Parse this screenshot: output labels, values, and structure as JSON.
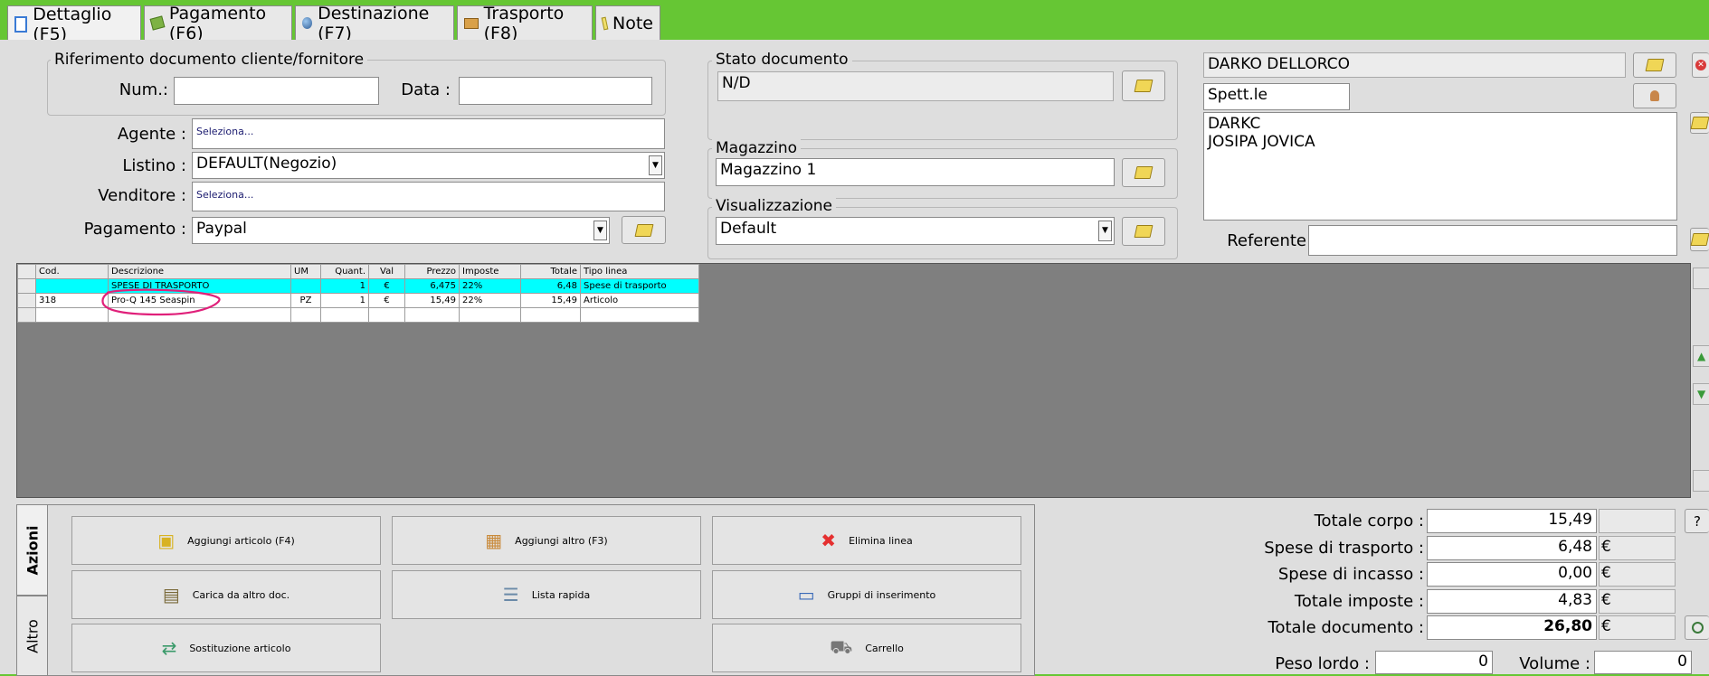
{
  "tabs": [
    {
      "label": "Dettaglio (F5)",
      "icon": "document-icon",
      "color": "#3a7bd5"
    },
    {
      "label": "Pagamento (F6)",
      "icon": "money-icon",
      "color": "#5a8f29"
    },
    {
      "label": "Destinazione (F7)",
      "icon": "globe-icon",
      "color": "#3b6ea8"
    },
    {
      "label": "Trasporto (F8)",
      "icon": "truck-icon",
      "color": "#c08a30"
    },
    {
      "label": "Note",
      "icon": "note-icon",
      "color": "#e8d552"
    }
  ],
  "riferimento": {
    "title": "Riferimento documento cliente/fornitore",
    "num_label": "Num.:",
    "num_value": "",
    "data_label": "Data :",
    "data_value": ""
  },
  "form": {
    "agente_label": "Agente :",
    "agente_value": "Seleziona...",
    "listino_label": "Listino :",
    "listino_value": "DEFAULT(Negozio)",
    "venditore_label": "Venditore :",
    "venditore_value": "Seleziona...",
    "pagamento_label": "Pagamento :",
    "pagamento_value": "Paypal"
  },
  "stato": {
    "title": "Stato documento",
    "value": "N/D"
  },
  "magazzino": {
    "title": "Magazzino",
    "value": "Magazzino 1"
  },
  "visualizzazione": {
    "title": "Visualizzazione",
    "value": "Default"
  },
  "cliente": {
    "name": "DARKO DELLORCO",
    "salutation": "Spett.le",
    "address_lines": [
      "DARKC",
      "JOSIPA JOVICA"
    ],
    "referente_label": "Referente",
    "referente_value": ""
  },
  "table": {
    "columns": [
      "Cod.",
      "Descrizione",
      "UM",
      "Quant.",
      "Val",
      "Prezzo",
      "Imposte",
      "Totale",
      "Tipo linea"
    ],
    "rows": [
      {
        "cod": "",
        "descrizione": "SPESE DI TRASPORTO",
        "um": "",
        "quant": "1",
        "val": "€",
        "prezzo": "6,475",
        "imposte": "22%",
        "totale": "6,48",
        "tipo": "Spese di trasporto"
      },
      {
        "cod": "318",
        "descrizione": "Pro-Q 145 Seaspin",
        "um": "PZ",
        "quant": "1",
        "val": "€",
        "prezzo": "15,49",
        "imposte": "22%",
        "totale": "15,49",
        "tipo": "Articolo"
      }
    ],
    "highlight_color": "#00ffff"
  },
  "side_tabs": {
    "azioni": "Azioni",
    "altro": "Altro"
  },
  "actions": [
    {
      "label": "Aggiungi articolo (F4)",
      "icon": "add-article-icon"
    },
    {
      "label": "Aggiungi altro (F3)",
      "icon": "add-other-icon"
    },
    {
      "label": "Elimina linea",
      "icon": "delete-icon"
    },
    {
      "label": "Carica da altro doc.",
      "icon": "load-doc-icon"
    },
    {
      "label": "Lista rapida",
      "icon": "quick-list-icon"
    },
    {
      "label": "Gruppi di inserimento",
      "icon": "insert-group-icon"
    },
    {
      "label": "Sostituzione articolo",
      "icon": "replace-icon"
    },
    {
      "label": "Carrello",
      "icon": "cart-icon"
    }
  ],
  "totals": {
    "totale_corpo_label": "Totale corpo :",
    "totale_corpo": "15,49",
    "help": "?",
    "spese_trasporto_label": "Spese di trasporto :",
    "spese_trasporto": "6,48",
    "spese_incasso_label": "Spese di incasso :",
    "spese_incasso": "0,00",
    "totale_imposte_label": "Totale imposte :",
    "totale_imposte": "4,83",
    "totale_documento_label": "Totale documento :",
    "totale_documento": "26,80",
    "currency": "€",
    "peso_lordo_label": "Peso lordo :",
    "peso_lordo": "0",
    "volume_label": "Volume :",
    "volume": "0"
  },
  "colors": {
    "window_bg": "#66c634",
    "panel_bg": "#dedede",
    "grid_bg": "#7f7f7f",
    "annotation": "#e0207a",
    "delete_red": "#e53030"
  }
}
